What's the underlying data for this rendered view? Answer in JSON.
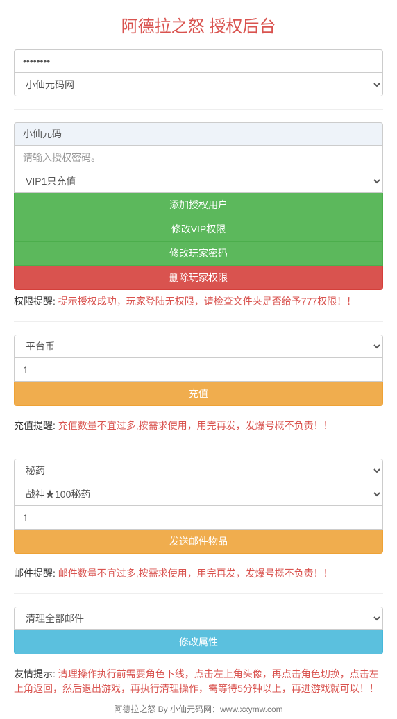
{
  "title": "阿德拉之怒 授权后台",
  "section1": {
    "password_value": "••••••••",
    "select_value": "小仙元码网"
  },
  "section2": {
    "readonly_value": "小仙元码",
    "password_placeholder": "请输入授权密码。",
    "vip_select_value": "VIP1只充值",
    "btn_add": "添加授权用户",
    "btn_modify_vip": "修改VIP权限",
    "btn_modify_pwd": "修改玩家密码",
    "btn_delete": "删除玩家权限",
    "hint_label": "权限提醒: ",
    "hint_text": "提示授权成功，玩家登陆无权限，请检查文件夹是否给予777权限！！"
  },
  "section3": {
    "select_value": "平台币",
    "amount_value": "1",
    "btn_recharge": "充值",
    "hint_label": "充值提醒: ",
    "hint_text": "充值数量不宜过多,按需求使用，用完再发，发爆号概不负责！！"
  },
  "section4": {
    "select1_value": "秘药",
    "select2_value": "战神★100秘药",
    "amount_value": "1",
    "btn_send": "发送邮件物品",
    "hint_label": "邮件提醒: ",
    "hint_text": "邮件数量不宜过多,按需求使用，用完再发，发爆号概不负责！！"
  },
  "section5": {
    "select_value": "清理全部邮件",
    "btn_modify": "修改属性",
    "hint_label": "友情提示: ",
    "hint_text": "清理操作执行前需要角色下线，点击左上角头像，再点击角色切换，点击左上角返回，然后退出游戏，再执行清理操作，需等待5分钟以上，再进游戏就可以！！"
  },
  "footer": "阿德拉之怒 By 小仙元码网：www.xxymw.com"
}
